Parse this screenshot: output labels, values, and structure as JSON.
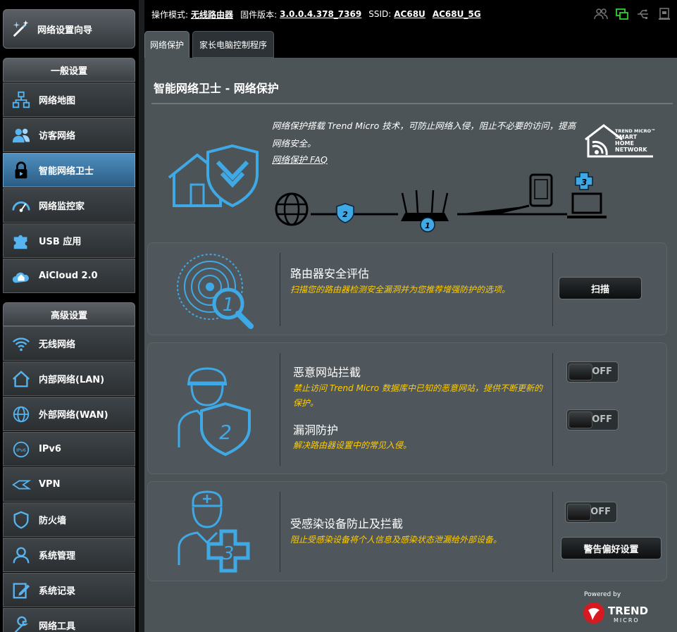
{
  "sidebar": {
    "wizard_label": "网络设置向导",
    "general_heading": "一般设置",
    "general_items": [
      {
        "label": "网络地图",
        "icon": "network-map-icon"
      },
      {
        "label": "访客网络",
        "icon": "guest-network-icon"
      },
      {
        "label": "智能网络卫士",
        "icon": "lock-icon"
      },
      {
        "label": "网络监控家",
        "icon": "speedometer-icon"
      },
      {
        "label": "USB 应用",
        "icon": "puzzle-icon"
      },
      {
        "label": "AiCloud 2.0",
        "icon": "cloud-home-icon"
      }
    ],
    "advanced_heading": "高级设置",
    "advanced_items": [
      {
        "label": "无线网络",
        "icon": "wifi-icon"
      },
      {
        "label": "内部网络(LAN)",
        "icon": "home-icon"
      },
      {
        "label": "外部网络(WAN)",
        "icon": "globe-icon"
      },
      {
        "label": "IPv6",
        "icon": "ipv6-icon"
      },
      {
        "label": "VPN",
        "icon": "vpn-icon"
      },
      {
        "label": "防火墙",
        "icon": "shield-icon"
      },
      {
        "label": "系统管理",
        "icon": "admin-user-icon"
      },
      {
        "label": "系统记录",
        "icon": "log-edit-icon"
      },
      {
        "label": "网络工具",
        "icon": "wrench-icon"
      }
    ],
    "active_item": "智能网络卫士"
  },
  "topbar": {
    "mode_label": "操作模式:",
    "mode_value": "无线路由器",
    "firmware_label": "固件版本:",
    "firmware_value": "3.0.0.4.378_7369",
    "ssid_label": "SSID:",
    "ssid_1": "AC68U",
    "ssid_2": "AC68U_5G",
    "icons": [
      "clients-icon",
      "network-status-icon",
      "usb-icon",
      "printer-icon"
    ]
  },
  "tabs": [
    {
      "label": "网络保护",
      "active": true
    },
    {
      "label": "家长电脑控制程序",
      "active": false
    }
  ],
  "main": {
    "title": "智能网络卫士 - 网络保护",
    "intro": "网络保护搭载 Trend Micro 技术，可防止网络入侵，阻止不必要的访问，提高网络安全。",
    "faq_link": "网络保护 FAQ",
    "brand_text": "TREND MICRO™ SMART HOME NETWORK",
    "diagram_badges": [
      "1",
      "2",
      "3"
    ]
  },
  "panels": {
    "assessment": {
      "badge": "1",
      "title": "路由器安全评估",
      "description": "扫描您的路由器检测安全漏洞并为您推荐增强防护的选项。",
      "button_label": "扫描"
    },
    "protection": {
      "badge": "2",
      "malicious_title": "恶意网站拦截",
      "malicious_desc": "禁止访问 Trend Micro 数据库中已知的恶意网站，提供不断更新的保护。",
      "malicious_toggle": "OFF",
      "vuln_title": "漏洞防护",
      "vuln_desc": "解决路由器设置中的常见入侵。",
      "vuln_toggle": "OFF"
    },
    "infected": {
      "badge": "3",
      "title": "受感染设备防止及拦截",
      "description": "阻止受感染设备将个人信息及感染状态泄漏给外部设备。",
      "toggle": "OFF",
      "button_label": "警告偏好设置"
    }
  },
  "footer": {
    "powered_by": "Powered by",
    "logo_text": "TREND",
    "logo_sub": "MICRO"
  },
  "colors": {
    "accent_blue": "#3fa9e6",
    "desc_yellow": "#ffcc00",
    "active_nav": "#3a7bab"
  }
}
